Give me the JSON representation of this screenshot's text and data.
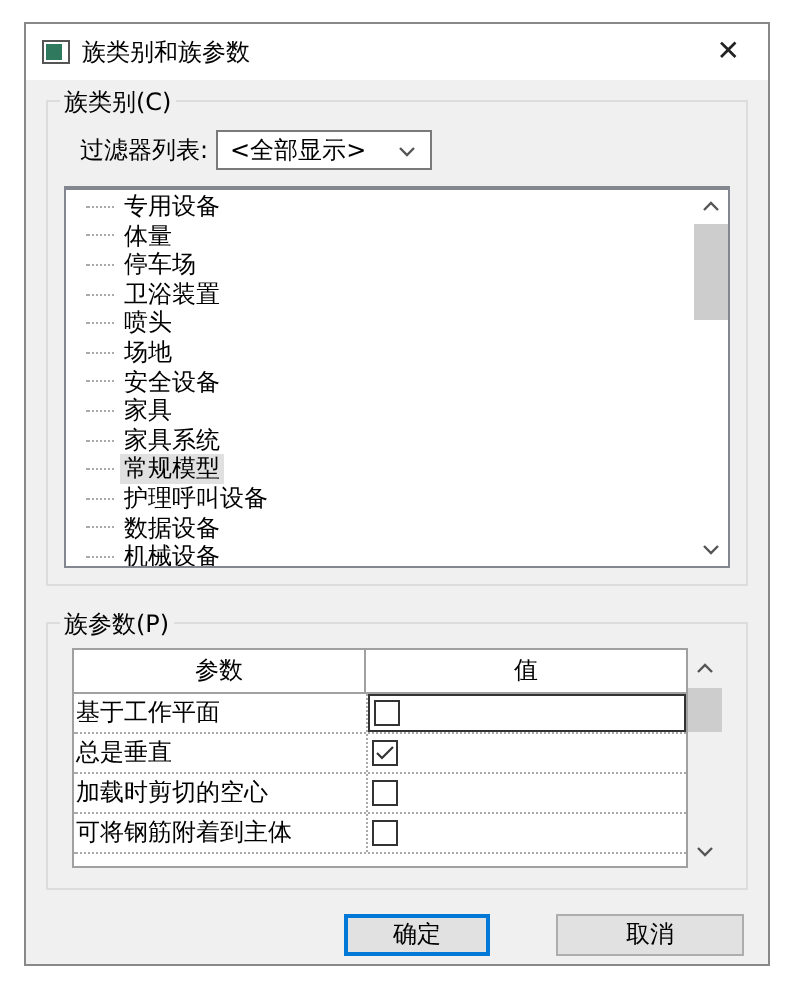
{
  "window": {
    "title": "族类别和族参数",
    "close": "✕"
  },
  "category_group": {
    "title": "族类别(C)",
    "filter_label": "过滤器列表:",
    "filter_value": "<全部显示>",
    "items": [
      {
        "label": "专用设备",
        "selected": false
      },
      {
        "label": "体量",
        "selected": false
      },
      {
        "label": "停车场",
        "selected": false
      },
      {
        "label": "卫浴装置",
        "selected": false
      },
      {
        "label": "喷头",
        "selected": false
      },
      {
        "label": "场地",
        "selected": false
      },
      {
        "label": "安全设备",
        "selected": false
      },
      {
        "label": "家具",
        "selected": false
      },
      {
        "label": "家具系统",
        "selected": false
      },
      {
        "label": "常规模型",
        "selected": true
      },
      {
        "label": "护理呼叫设备",
        "selected": false
      },
      {
        "label": "数据设备",
        "selected": false
      },
      {
        "label": "机械设备",
        "selected": false
      }
    ]
  },
  "param_group": {
    "title": "族参数(P)",
    "columns": [
      "参数",
      "值"
    ],
    "rows": [
      {
        "name": "基于工作平面",
        "checked": false,
        "selected": true
      },
      {
        "name": "总是垂直",
        "checked": true,
        "selected": false
      },
      {
        "name": "加载时剪切的空心",
        "checked": false,
        "selected": false
      },
      {
        "name": "可将钢筋附着到主体",
        "checked": false,
        "selected": false
      }
    ]
  },
  "buttons": [
    {
      "label": "确定",
      "kind": "default"
    },
    {
      "label": "取消",
      "kind": "normal"
    }
  ]
}
